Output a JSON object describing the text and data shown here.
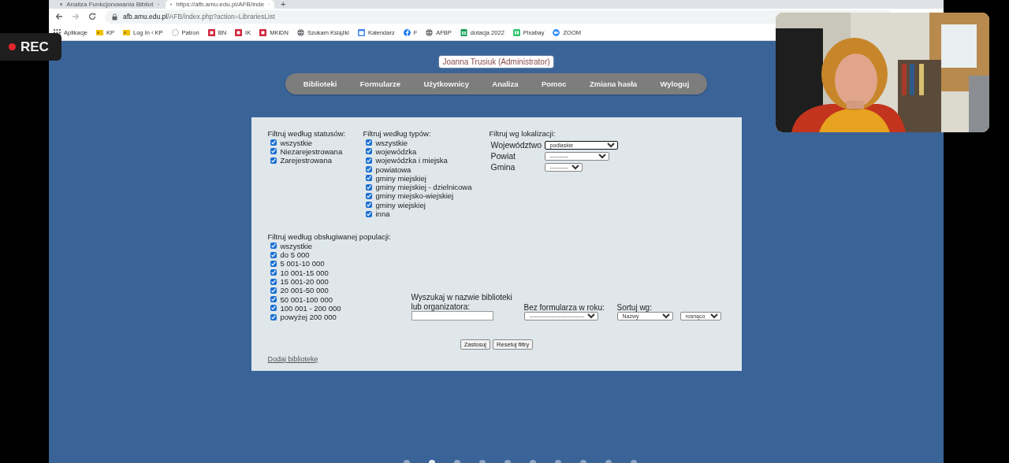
{
  "browser": {
    "tabs": [
      {
        "title": "Analiza Funkcjonowania Bibliot",
        "selected": false
      },
      {
        "title": "https://afb.amu.edu.pl/AFB/inde",
        "selected": true
      }
    ],
    "new_tab": "+",
    "address": {
      "host": "afb.amu.edu.pl",
      "path": "/AFB/index.php?action=LibrariesList"
    },
    "bookmarks": [
      {
        "label": "Aplikacje",
        "kind": "apps"
      },
      {
        "label": "KP",
        "kind": "k"
      },
      {
        "label": "Log In ‹ KP",
        "kind": "k"
      },
      {
        "label": "Patron",
        "kind": "ring"
      },
      {
        "label": "BN",
        "kind": "red"
      },
      {
        "label": "IK",
        "kind": "red"
      },
      {
        "label": "MKiDN",
        "kind": "red"
      },
      {
        "label": "Szukam Książki",
        "kind": "globe"
      },
      {
        "label": "Kalendarz",
        "kind": "calendar"
      },
      {
        "label": "F",
        "kind": "fb"
      },
      {
        "label": "AFBP",
        "kind": "globe"
      },
      {
        "label": "dotacja 2022",
        "kind": "sheet"
      },
      {
        "label": "Pixabay",
        "kind": "px"
      },
      {
        "label": "ZOOM",
        "kind": "zoom"
      }
    ]
  },
  "rec_badge": "REC",
  "user_label": "Joanna Trusiuk (Administrator)",
  "nav": [
    "Biblioteki",
    "Formularze",
    "Użytkownicy",
    "Analiza",
    "Pomoc",
    "Zmiana hasła",
    "Wyloguj"
  ],
  "filters": {
    "status": {
      "title": "Filtruj według statusów:",
      "options": [
        {
          "label": "wszystkie",
          "checked": true
        },
        {
          "label": "Niezarejestrowana",
          "checked": true
        },
        {
          "label": "Zarejestrowana",
          "checked": true
        }
      ]
    },
    "types": {
      "title": "Filtruj według typów:",
      "options": [
        {
          "label": "wszystkie",
          "checked": true
        },
        {
          "label": "wojewódzka",
          "checked": true
        },
        {
          "label": "wojewódzka i miejska",
          "checked": true
        },
        {
          "label": "powiatowa",
          "checked": true
        },
        {
          "label": "gminy miejskiej",
          "checked": true
        },
        {
          "label": "gminy miejskiej - dzielnicowa",
          "checked": true
        },
        {
          "label": "gminy miejsko-wiejskiej",
          "checked": true
        },
        {
          "label": "gminy wiejskiej",
          "checked": true
        },
        {
          "label": "inna",
          "checked": true
        }
      ]
    },
    "location": {
      "title": "Filtruj wg lokalizacji:",
      "fields": [
        {
          "label": "Województwo",
          "value": "podlaskie",
          "focused": true
        },
        {
          "label": "Powiat",
          "value": "----------",
          "focused": false
        },
        {
          "label": "Gmina",
          "value": "----------",
          "focused": false
        }
      ]
    },
    "population": {
      "title": "Filtruj według obsługiwanej populacji:",
      "options": [
        {
          "label": "wszystkie",
          "checked": true
        },
        {
          "label": "do 5 000",
          "checked": true
        },
        {
          "label": "5 001-10 000",
          "checked": true
        },
        {
          "label": "10 001-15 000",
          "checked": true
        },
        {
          "label": "15 001-20 000",
          "checked": true
        },
        {
          "label": "20 001-50 000",
          "checked": true
        },
        {
          "label": "50 001-100 000",
          "checked": true
        },
        {
          "label": "100 001 - 200 000",
          "checked": true
        },
        {
          "label": "powyżej 200 000",
          "checked": true
        }
      ]
    },
    "search": {
      "label": "Wyszukaj w nazwie biblioteki lub organizatora:"
    },
    "no_form": {
      "label": "Bez formularza w roku:",
      "value": "------------------------------"
    },
    "sort": {
      "label": "Sortuj wg:",
      "value": "Nazwy",
      "order": "rosnąco"
    }
  },
  "buttons": [
    "Zastosuj",
    "Resetuj filtry"
  ],
  "add_link": "Dodaj bibliotekę",
  "video": {
    "kind": "picture"
  },
  "carousel": [
    {
      "selected": false
    },
    {
      "selected": true
    },
    {
      "selected": false
    },
    {
      "selected": false
    },
    {
      "selected": false
    },
    {
      "selected": false
    },
    {
      "selected": false
    },
    {
      "selected": false
    },
    {
      "selected": false
    },
    {
      "selected": false
    }
  ]
}
